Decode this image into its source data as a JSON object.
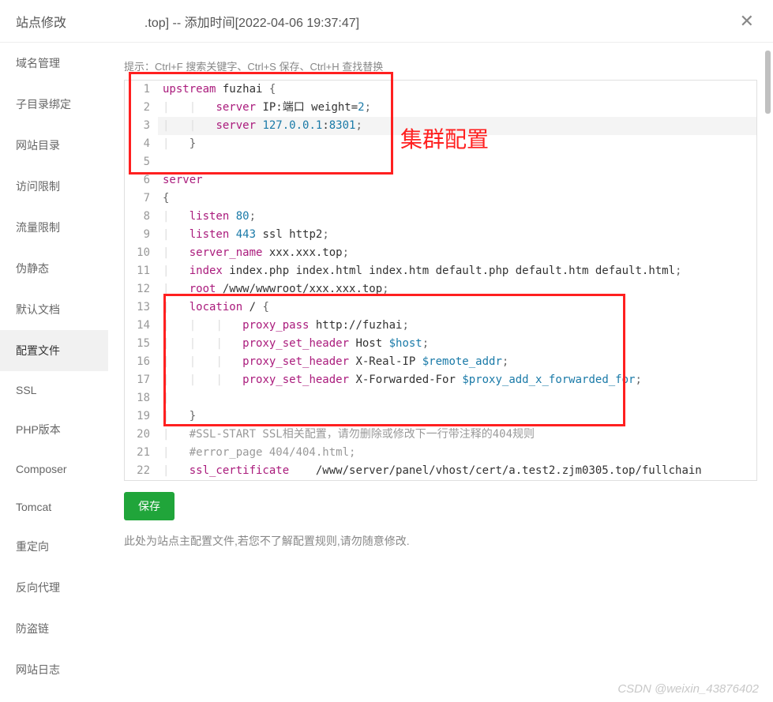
{
  "header": {
    "title_prefix": "站点修改",
    "title_suffix": ".top] -- 添加时间[2022-04-06 19:37:47]"
  },
  "sidebar": {
    "items": [
      {
        "label": "域名管理"
      },
      {
        "label": "子目录绑定"
      },
      {
        "label": "网站目录"
      },
      {
        "label": "访问限制"
      },
      {
        "label": "流量限制"
      },
      {
        "label": "伪静态"
      },
      {
        "label": "默认文档"
      },
      {
        "label": "配置文件",
        "active": true
      },
      {
        "label": "SSL"
      },
      {
        "label": "PHP版本"
      },
      {
        "label": "Composer"
      },
      {
        "label": "Tomcat"
      },
      {
        "label": "重定向"
      },
      {
        "label": "反向代理"
      },
      {
        "label": "防盗链"
      },
      {
        "label": "网站日志"
      }
    ]
  },
  "content": {
    "hint": "提示：Ctrl+F 搜索关键字、Ctrl+S 保存、Ctrl+H 查找替换",
    "save_label": "保存",
    "warning": "此处为站点主配置文件,若您不了解配置规则,请勿随意修改."
  },
  "annotations": {
    "cluster_config": "集群配置"
  },
  "code": {
    "lines": [
      {
        "n": 1,
        "tokens": [
          [
            "kw",
            "upstream"
          ],
          [
            "val",
            " fuzhai "
          ],
          [
            "punct",
            "{"
          ]
        ]
      },
      {
        "n": 2,
        "indent": 2,
        "tokens": [
          [
            "kw",
            "server"
          ],
          [
            "val",
            " IP:端口 weight="
          ],
          [
            "num",
            "2"
          ],
          [
            "punct",
            ";"
          ]
        ]
      },
      {
        "n": 3,
        "indent": 2,
        "highlighted": true,
        "tokens": [
          [
            "kw",
            "server"
          ],
          [
            "val",
            " "
          ],
          [
            "num",
            "127.0.0.1"
          ],
          [
            "val",
            ":"
          ],
          [
            "num",
            "8301"
          ],
          [
            "punct",
            ";"
          ]
        ]
      },
      {
        "n": 4,
        "indent": 1,
        "tokens": [
          [
            "punct",
            "}"
          ]
        ]
      },
      {
        "n": 5,
        "tokens": []
      },
      {
        "n": 6,
        "tokens": [
          [
            "kw",
            "server"
          ]
        ]
      },
      {
        "n": 7,
        "tokens": [
          [
            "punct",
            "{"
          ]
        ]
      },
      {
        "n": 8,
        "indent": 1,
        "tokens": [
          [
            "kw",
            "listen"
          ],
          [
            "val",
            " "
          ],
          [
            "num",
            "80"
          ],
          [
            "punct",
            ";"
          ]
        ]
      },
      {
        "n": 9,
        "indent": 1,
        "tokens": [
          [
            "kw",
            "listen"
          ],
          [
            "val",
            " "
          ],
          [
            "num",
            "443"
          ],
          [
            "val",
            " ssl http2"
          ],
          [
            "punct",
            ";"
          ]
        ]
      },
      {
        "n": 10,
        "indent": 1,
        "tokens": [
          [
            "kw",
            "server_name"
          ],
          [
            "val",
            " xxx.xxx.top"
          ],
          [
            "punct",
            ";"
          ]
        ]
      },
      {
        "n": 11,
        "indent": 1,
        "tokens": [
          [
            "kw",
            "index"
          ],
          [
            "val",
            " index.php index.html index.htm default.php default.htm default.html"
          ],
          [
            "punct",
            ";"
          ]
        ]
      },
      {
        "n": 12,
        "indent": 1,
        "tokens": [
          [
            "kw",
            "root"
          ],
          [
            "val",
            " /www/wwwroot/xxx.xxx.top"
          ],
          [
            "punct",
            ";"
          ]
        ]
      },
      {
        "n": 13,
        "indent": 1,
        "tokens": [
          [
            "kw",
            "location"
          ],
          [
            "val",
            " / "
          ],
          [
            "punct",
            "{"
          ]
        ]
      },
      {
        "n": 14,
        "indent": 3,
        "tokens": [
          [
            "kw",
            "proxy_pass"
          ],
          [
            "val",
            " http://fuzhai"
          ],
          [
            "punct",
            ";"
          ]
        ]
      },
      {
        "n": 15,
        "indent": 3,
        "tokens": [
          [
            "kw",
            "proxy_set_header"
          ],
          [
            "val",
            " Host "
          ],
          [
            "var",
            "$host"
          ],
          [
            "punct",
            ";"
          ]
        ]
      },
      {
        "n": 16,
        "indent": 3,
        "tokens": [
          [
            "kw",
            "proxy_set_header"
          ],
          [
            "val",
            " X-Real-IP "
          ],
          [
            "var",
            "$remote_addr"
          ],
          [
            "punct",
            ";"
          ]
        ]
      },
      {
        "n": 17,
        "indent": 3,
        "tokens": [
          [
            "kw",
            "proxy_set_header"
          ],
          [
            "val",
            " X-Forwarded-For "
          ],
          [
            "var",
            "$proxy_add_x_forwarded_for"
          ],
          [
            "punct",
            ";"
          ]
        ]
      },
      {
        "n": 18,
        "indent": 1,
        "tokens": []
      },
      {
        "n": 19,
        "indent": 1,
        "tokens": [
          [
            "punct",
            "}"
          ]
        ]
      },
      {
        "n": 20,
        "indent": 1,
        "tokens": [
          [
            "comment",
            "#SSL-START SSL相关配置，请勿删除或修改下一行带注释的404规则"
          ]
        ]
      },
      {
        "n": 21,
        "indent": 1,
        "tokens": [
          [
            "comment",
            "#error_page 404/404.html;"
          ]
        ]
      },
      {
        "n": 22,
        "indent": 1,
        "tokens": [
          [
            "kw",
            "ssl_certificate"
          ],
          [
            "val",
            "    /www/server/panel/vhost/cert/a.test2.zjm0305.top/fullchain"
          ]
        ]
      }
    ]
  },
  "watermark": "CSDN @weixin_43876402"
}
